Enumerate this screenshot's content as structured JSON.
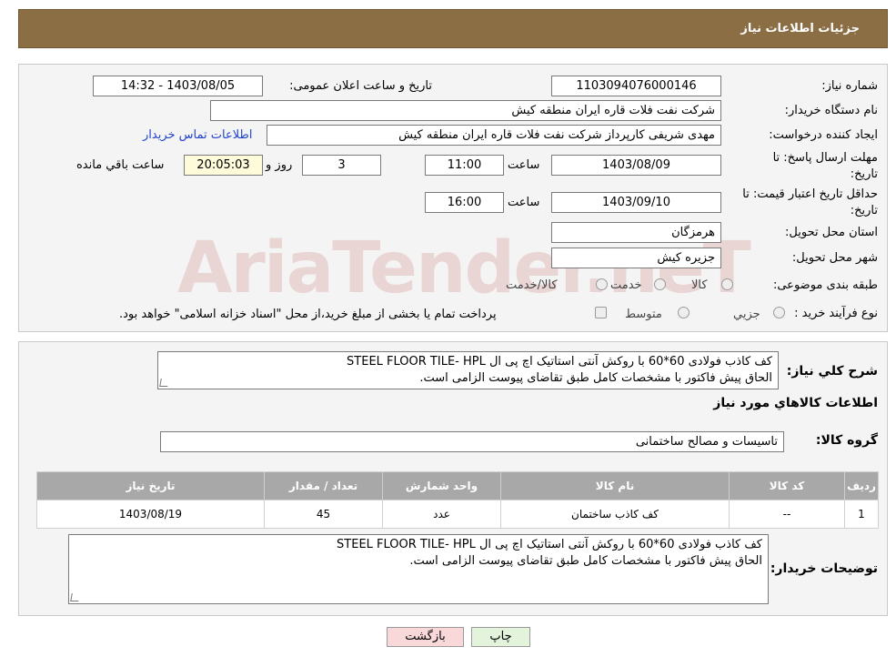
{
  "header": {
    "title": "جزئیات اطلاعات نیاز"
  },
  "form": {
    "need_number_label": "شماره نیاز:",
    "need_number": "1103094076000146",
    "announce_label": "تاریخ و ساعت اعلان عمومی:",
    "announce_value": "1403/08/05 - 14:32",
    "buyer_org_label": "نام دستگاه خریدار:",
    "buyer_org": "شرکت نفت فلات قاره ایران منطقه کیش",
    "creator_label": "ایجاد کننده درخواست:",
    "creator": "مهدی شریفی کارپرداز شرکت نفت فلات قاره ایران منطقه کیش",
    "contact_link": "اطلاعات تماس خریدار",
    "deadline_label_1": "مهلت ارسال پاسخ: تا",
    "deadline_label_2": "تاریخ:",
    "deadline_date": "1403/08/09",
    "time_label": "ساعت",
    "deadline_time": "11:00",
    "days_value": "3",
    "days_label": "روز و",
    "remaining_time": "20:05:03",
    "remaining_label": "ساعت باقي مانده",
    "validity_label_1": "حداقل تاریخ اعتبار قیمت: تا",
    "validity_label_2": "تاریخ:",
    "validity_date": "1403/09/10",
    "validity_time": "16:00",
    "province_label": "استان محل تحویل:",
    "province": "هرمزگان",
    "city_label": "شهر محل تحویل:",
    "city": "جزیره کیش",
    "category_label": "طبقه بندی موضوعی:",
    "category_options": [
      "کالا",
      "خدمت",
      "کالا/خدمت"
    ],
    "process_label": "نوع فرآیند خرید :",
    "process_options": [
      "جزیي",
      "متوسط"
    ],
    "process_note": "پرداخت تمام یا بخشی از مبلغ خرید،از محل \"اسناد خزانه اسلامی\" خواهد بود."
  },
  "summary": {
    "label": "شرح كلي نياز:",
    "line1": "کف کاذب فولادی 60*60 با روکش آنتی استاتیک اچ پی ال STEEL FLOOR TILE- HPL",
    "line2": "الحاق پیش فاکتور با مشخصات کامل طبق تقاضای پیوست الزامی است.",
    "items_heading": "اطلاعات كالاهاي مورد نياز",
    "group_label": "گروه کالا:",
    "group_value": "تاسیسات و مصالح ساختمانی"
  },
  "table": {
    "headers": [
      "ردیف",
      "کد کالا",
      "نام کالا",
      "واحد شمارش",
      "تعداد / مقدار",
      "تاریخ نیاز"
    ],
    "rows": [
      [
        "1",
        "--",
        "کف کاذب ساختمان",
        "عدد",
        "45",
        "1403/08/19"
      ]
    ]
  },
  "buyer_notes": {
    "label": "توضیحات خریدار:",
    "line1": "کف کاذب فولادی 60*60 با روکش آنتی استاتیک اچ پی ال STEEL FLOOR TILE- HPL",
    "line2": "الحاق پیش فاکتور با مشخصات کامل طبق تقاضای پیوست الزامی است."
  },
  "buttons": {
    "print": "چاپ",
    "back": "بازگشت"
  },
  "watermark": "AriaTender.neT",
  "colors": {
    "header_bg": "#8c6e45",
    "panel_bg": "#f4f4f4",
    "table_header_bg": "#a8a8a8",
    "link": "#2244cc",
    "back_button_bg": "#f8d8d8",
    "print_button_bg": "#e3f3dc"
  }
}
